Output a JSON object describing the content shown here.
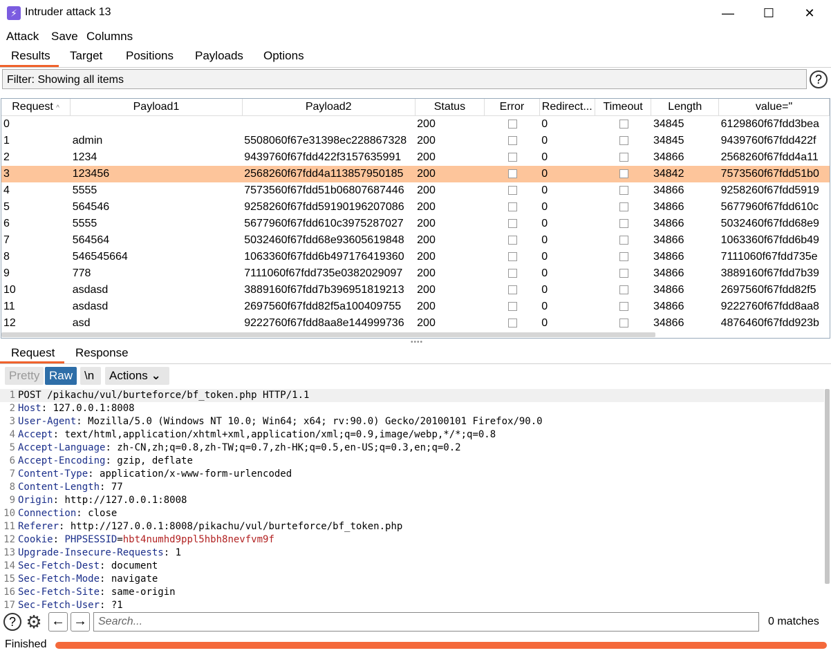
{
  "window": {
    "title": "Intruder attack 13",
    "minimize": "—",
    "maximize": "☐",
    "close": "✕"
  },
  "menu": {
    "items": [
      "Attack",
      "Save",
      "Columns"
    ]
  },
  "tabs": [
    "Results",
    "Target",
    "Positions",
    "Payloads",
    "Options"
  ],
  "filter": {
    "text": "Filter: Showing all items",
    "help": "?"
  },
  "table": {
    "columns": [
      "Request",
      "Payload1",
      "Payload2",
      "Status",
      "Error",
      "Redirect...",
      "Timeout",
      "Length",
      "value=\""
    ],
    "sort_indicator": "^",
    "selected_row": 3,
    "rows": [
      [
        "0",
        "",
        "",
        "200",
        "0",
        "34845",
        "6129860f67fdd3bea"
      ],
      [
        "1",
        "admin",
        "5508060f67e31398ec228867328",
        "200",
        "0",
        "34845",
        "9439760f67fdd422f"
      ],
      [
        "2",
        "1234",
        "9439760f67fdd422f3157635991",
        "200",
        "0",
        "34866",
        "2568260f67fdd4a11"
      ],
      [
        "3",
        "123456",
        "2568260f67fdd4a113857950185",
        "200",
        "0",
        "34842",
        "7573560f67fdd51b0"
      ],
      [
        "4",
        "5555",
        "7573560f67fdd51b06807687446",
        "200",
        "0",
        "34866",
        "9258260f67fdd5919"
      ],
      [
        "5",
        "564546",
        "9258260f67fdd59190196207086",
        "200",
        "0",
        "34866",
        "5677960f67fdd610c"
      ],
      [
        "6",
        "5555",
        "5677960f67fdd610c3975287027",
        "200",
        "0",
        "34866",
        "5032460f67fdd68e9"
      ],
      [
        "7",
        "564564",
        "5032460f67fdd68e93605619848",
        "200",
        "0",
        "34866",
        "1063360f67fdd6b49"
      ],
      [
        "8",
        "546545664",
        "1063360f67fdd6b497176419360",
        "200",
        "0",
        "34866",
        "7111060f67fdd735e"
      ],
      [
        "9",
        "778",
        "7111060f67fdd735e0382029097",
        "200",
        "0",
        "34866",
        "3889160f67fdd7b39"
      ],
      [
        "10",
        "asdasd",
        "3889160f67fdd7b396951819213",
        "200",
        "0",
        "34866",
        "2697560f67fdd82f5"
      ],
      [
        "11",
        "asdasd",
        "2697560f67fdd82f5a100409755",
        "200",
        "0",
        "34866",
        "9222760f67fdd8aa8"
      ],
      [
        "12",
        "asd",
        "9222760f67fdd8aa8e144999736",
        "200",
        "0",
        "34866",
        "4876460f67fdd923b"
      ]
    ]
  },
  "lower_tabs": [
    "Request",
    "Response"
  ],
  "editor_toolbar": {
    "pretty": "Pretty",
    "raw": "Raw",
    "newline": "\\n",
    "actions": "Actions",
    "actions_chevron": "⌄"
  },
  "request_lines": [
    {
      "n": "1",
      "key": "",
      "sep": "",
      "val": "POST /pikachu/vul/burteforce/bf_token.php HTTP/1.1"
    },
    {
      "n": "2",
      "key": "Host",
      "sep": ": ",
      "val": "127.0.0.1:8008"
    },
    {
      "n": "3",
      "key": "User-Agent",
      "sep": ": ",
      "val": "Mozilla/5.0 (Windows NT 10.0; Win64; x64; rv:90.0) Gecko/20100101 Firefox/90.0"
    },
    {
      "n": "4",
      "key": "Accept",
      "sep": ": ",
      "val": "text/html,application/xhtml+xml,application/xml;q=0.9,image/webp,*/*;q=0.8"
    },
    {
      "n": "5",
      "key": "Accept-Language",
      "sep": ": ",
      "val": "zh-CN,zh;q=0.8,zh-TW;q=0.7,zh-HK;q=0.5,en-US;q=0.3,en;q=0.2"
    },
    {
      "n": "6",
      "key": "Accept-Encoding",
      "sep": ": ",
      "val": "gzip, deflate"
    },
    {
      "n": "7",
      "key": "Content-Type",
      "sep": ": ",
      "val": "application/x-www-form-urlencoded"
    },
    {
      "n": "8",
      "key": "Content-Length",
      "sep": ": ",
      "val": "77"
    },
    {
      "n": "9",
      "key": "Origin",
      "sep": ": ",
      "val": "http://127.0.0.1:8008"
    },
    {
      "n": "10",
      "key": "Connection",
      "sep": ": ",
      "val": "close"
    },
    {
      "n": "11",
      "key": "Referer",
      "sep": ": ",
      "val": "http://127.0.0.1:8008/pikachu/vul/burteforce/bf_token.php"
    },
    {
      "n": "12",
      "key": "Cookie",
      "sep": ": ",
      "val": "",
      "cookie_name": "PHPSESSID",
      "cookie_eq": "=",
      "cookie_value": "hbt4numhd9ppl5hbh8nevfvm9f"
    },
    {
      "n": "13",
      "key": "Upgrade-Insecure-Requests",
      "sep": ": ",
      "val": "1"
    },
    {
      "n": "14",
      "key": "Sec-Fetch-Dest",
      "sep": ": ",
      "val": "document"
    },
    {
      "n": "15",
      "key": "Sec-Fetch-Mode",
      "sep": ": ",
      "val": "navigate"
    },
    {
      "n": "16",
      "key": "Sec-Fetch-Site",
      "sep": ": ",
      "val": "same-origin"
    },
    {
      "n": "17",
      "key": "Sec-Fetch-User",
      "sep": ": ",
      "val": "?1"
    }
  ],
  "search": {
    "help": "?",
    "back": "←",
    "forward": "→",
    "placeholder": "Search...",
    "matches": "0 matches"
  },
  "status": {
    "text": "Finished",
    "progress": 1.0
  },
  "colors": {
    "accent": "#f0622c",
    "selected_row": "#fdc59b",
    "raw_active": "#2e6ea8",
    "header_key": "#1a2e8a",
    "cookie_value": "#b22222"
  }
}
